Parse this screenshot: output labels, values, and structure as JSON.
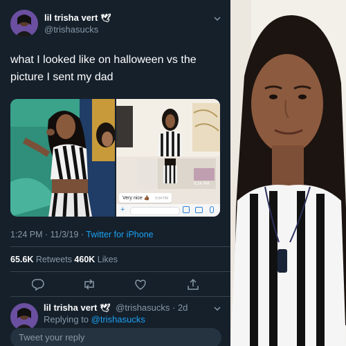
{
  "tweet": {
    "display_name": "lil trisha vert",
    "verified_emoji": "🕊",
    "handle": "@trishasucks",
    "text": "what I looked like on halloween vs the picture I sent my dad",
    "timestamp": "1:24 PM · 11/3/19 · ",
    "source": "Twitter for iPhone",
    "retweets_count": "65.6K",
    "retweets_label": " Retweets  ",
    "likes_count": "460K",
    "likes_label": " Likes"
  },
  "embedded_chat": {
    "photo_time": "9:24 PM",
    "message": "Very nice 👍🏾",
    "message_time": "9:34 PM"
  },
  "reply": {
    "display_name": "lil trisha vert",
    "verified_emoji": "🕊",
    "handle_time": "@trishasucks · 2d",
    "replying_prefix": "Replying to ",
    "replying_handle": "@trishasucks",
    "placeholder": "Tweet your reply"
  },
  "icons": {
    "reply": "reply-icon",
    "retweet": "retweet-icon",
    "like": "heart-icon",
    "share": "share-icon",
    "more": "chevron-down-icon"
  },
  "colors": {
    "background": "#15202b",
    "accent": "#1da1f2",
    "muted": "#8899a6"
  }
}
